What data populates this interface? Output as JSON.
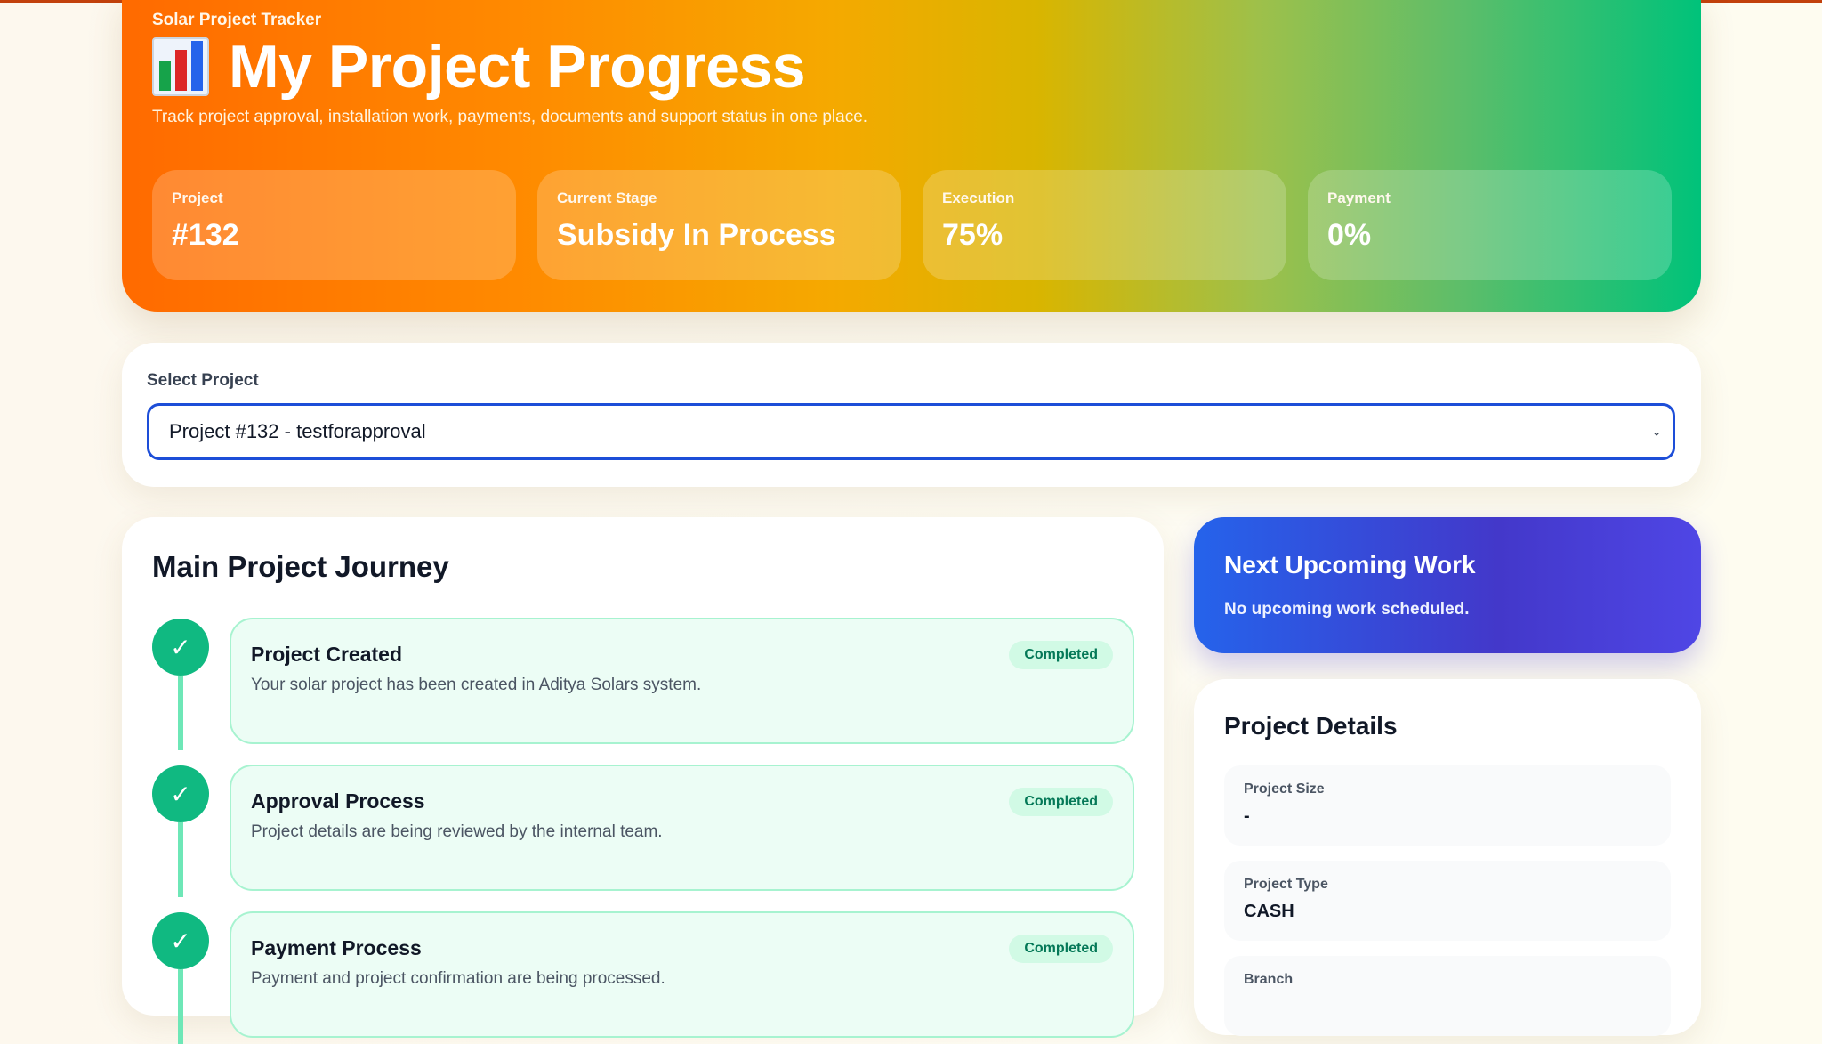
{
  "hero": {
    "kicker": "Solar Project Tracker",
    "icon": "bar-chart-icon",
    "title": "My Project Progress",
    "subtitle": "Track project approval, installation work, payments, documents and support status in one place.",
    "stats": [
      {
        "label": "Project",
        "value": "#132"
      },
      {
        "label": "Current Stage",
        "value": "Subsidy In Process"
      },
      {
        "label": "Execution",
        "value": "75%"
      },
      {
        "label": "Payment",
        "value": "0%"
      }
    ]
  },
  "select": {
    "label": "Select Project",
    "selected": "Project #132 - testforapproval",
    "chevron": "⌄"
  },
  "journey": {
    "title": "Main Project Journey",
    "check_glyph": "✓",
    "steps": [
      {
        "name": "Project Created",
        "desc": "Your solar project has been created in Aditya Solars system.",
        "status": "Completed"
      },
      {
        "name": "Approval Process",
        "desc": "Project details are being reviewed by the internal team.",
        "status": "Completed"
      },
      {
        "name": "Payment Process",
        "desc": "Payment and project confirmation are being processed.",
        "status": "Completed"
      }
    ]
  },
  "next_work": {
    "title": "Next Upcoming Work",
    "text": "No upcoming work scheduled."
  },
  "details": {
    "title": "Project Details",
    "items": [
      {
        "label": "Project Size",
        "value": "-"
      },
      {
        "label": "Project Type",
        "value": "CASH"
      },
      {
        "label": "Branch",
        "value": ""
      }
    ]
  },
  "colors": {
    "accent_blue": "#1d4ed8",
    "success": "#10b981",
    "hero_start": "#ff6a00",
    "hero_end": "#00c27a"
  }
}
